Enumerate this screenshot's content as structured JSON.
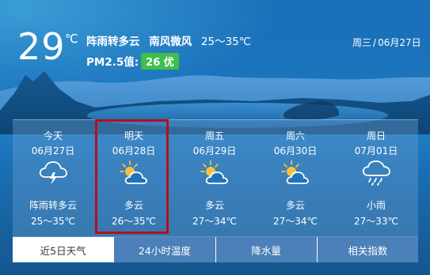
{
  "current": {
    "temp": "29",
    "unit": "℃",
    "condition": "阵雨转多云",
    "wind": "南风微风",
    "range": "25～35℃",
    "pm_label": "PM2.5值:",
    "aqi": "26 优",
    "weekday": "周三",
    "date": "06月27日"
  },
  "forecast": [
    {
      "name": "今天",
      "date": "06月27日",
      "icon": "thunderstorm-icon",
      "cond": "阵雨转多云",
      "range": "25～35℃"
    },
    {
      "name": "明天",
      "date": "06月28日",
      "icon": "partly-cloudy-icon",
      "cond": "多云",
      "range": "26～35℃"
    },
    {
      "name": "周五",
      "date": "06月29日",
      "icon": "partly-cloudy-icon",
      "cond": "多云",
      "range": "27～34℃"
    },
    {
      "name": "周六",
      "date": "06月30日",
      "icon": "partly-cloudy-icon",
      "cond": "多云",
      "range": "27～34℃"
    },
    {
      "name": "周日",
      "date": "07月01日",
      "icon": "light-rain-icon",
      "cond": "小雨",
      "range": "27～33℃"
    }
  ],
  "tabs": [
    {
      "label": "近5日天气",
      "active": true
    },
    {
      "label": "24小时温度",
      "active": false
    },
    {
      "label": "降水量",
      "active": false
    },
    {
      "label": "相关指数",
      "active": false
    }
  ],
  "colors": {
    "aqi_good": "#3fbf4a",
    "highlight": "#b5101b",
    "sky": "#1a6fb8"
  }
}
